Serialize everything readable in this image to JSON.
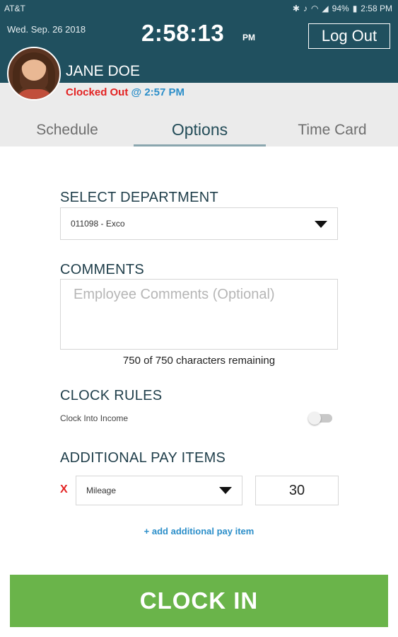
{
  "status_bar": {
    "carrier": "AT&T",
    "battery": "94%",
    "time": "2:58 PM"
  },
  "header": {
    "date": "Wed. Sep. 26 2018",
    "clock_time": "2:58:13",
    "ampm": "PM",
    "logout_label": "Log Out",
    "user_name": "JANE DOE",
    "status": "Clocked Out",
    "status_time": "@ 2:57 PM"
  },
  "tabs": [
    {
      "label": "Schedule",
      "active": false
    },
    {
      "label": "Options",
      "active": true
    },
    {
      "label": "Time Card",
      "active": false
    }
  ],
  "department": {
    "title": "SELECT DEPARTMENT",
    "selected": "011098 - Exco"
  },
  "comments": {
    "title": "COMMENTS",
    "placeholder": "Employee Comments (Optional)",
    "remaining": "750 of 750 characters remaining"
  },
  "clock_rules": {
    "title": "CLOCK RULES",
    "items": [
      {
        "label": "Clock Into Income",
        "enabled": false
      }
    ]
  },
  "pay_items": {
    "title": "ADDITIONAL PAY ITEMS",
    "remove_label": "X",
    "items": [
      {
        "type": "Mileage",
        "quantity": "30"
      }
    ],
    "add_label": "+ add additional pay item"
  },
  "clock_in_label": "CLOCK IN",
  "colors": {
    "header_bg": "#20505f",
    "clock_in_green": "#6ab44a",
    "status_red": "#e32222",
    "link_blue": "#2b8ec9"
  }
}
